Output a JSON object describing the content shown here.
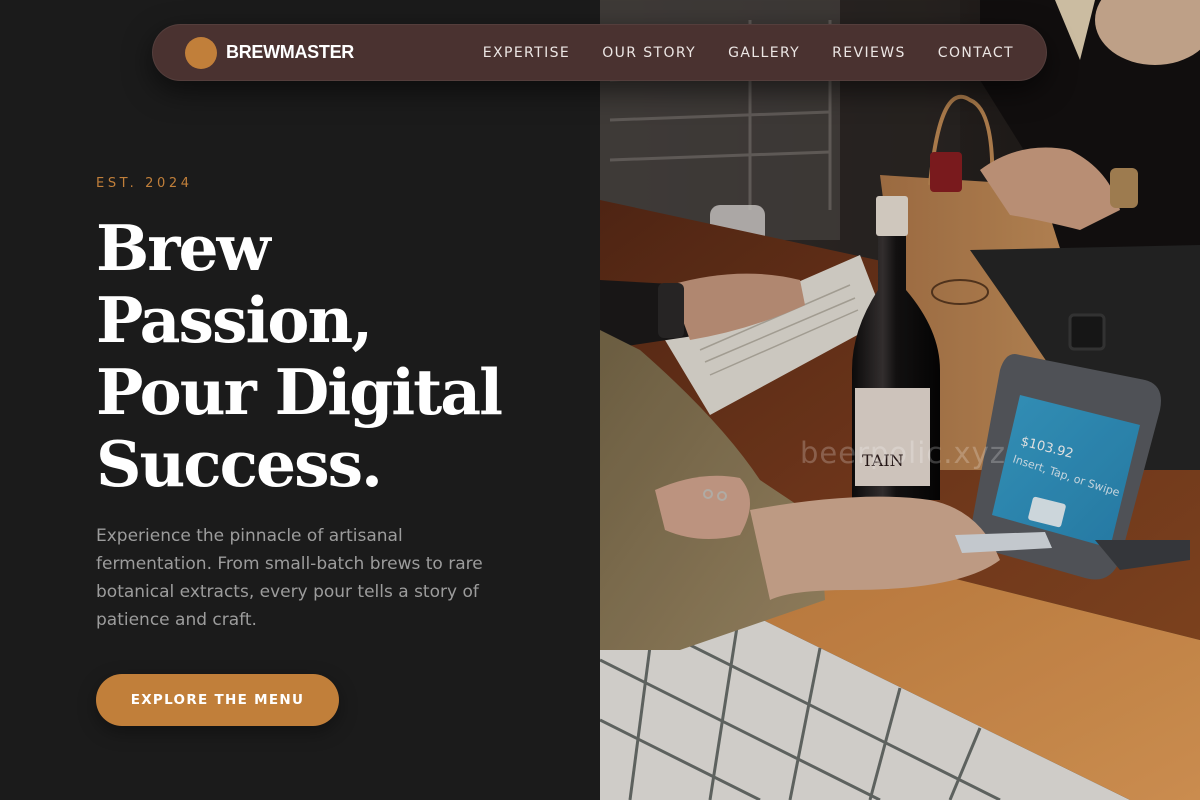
{
  "brand": {
    "name": "BREWMASTER",
    "accent_color": "#c17f3a"
  },
  "nav": {
    "links": [
      "EXPERTISE",
      "OUR STORY",
      "GALLERY",
      "REVIEWS",
      "CONTACT"
    ]
  },
  "hero": {
    "eyebrow": "EST. 2024",
    "headline_lines": [
      "Brew",
      "Passion,",
      "Pour Digital",
      "Success."
    ],
    "description": "Experience the pinnacle of artisanal fermentation. From small-batch brews to rare botanical extracts, every pour tells a story of patience and craft.",
    "cta_label": "EXPLORE THE MENU"
  },
  "photo": {
    "watermark": "beerpolic.xyz",
    "terminal_amount": "$103.92",
    "terminal_prompt": "Insert, Tap, or Swipe",
    "bottle_label": "TAIN"
  },
  "colors": {
    "background": "#1b1b1b",
    "navbar": "#4a3230",
    "muted_text": "#9c9c9c"
  }
}
